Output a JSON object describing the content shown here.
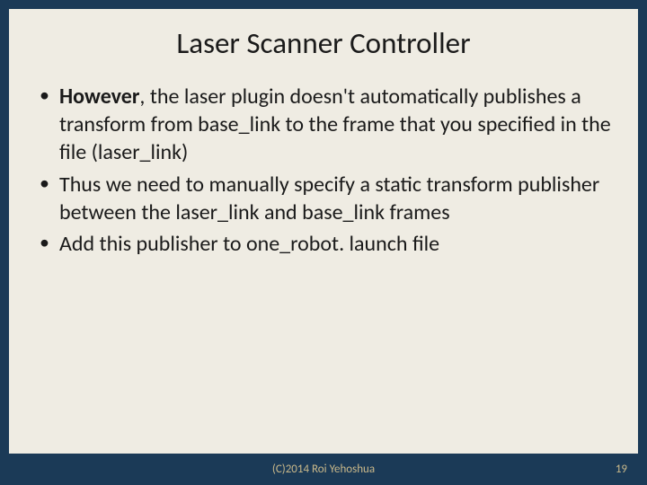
{
  "title": "Laser Scanner Controller",
  "bullets": [
    {
      "bold": "However",
      "rest": ", the laser plugin doesn't automatically publishes a transform from base_link to the frame that you specified in the file (laser_link)"
    },
    {
      "bold": "",
      "rest": "Thus we need to manually specify a static transform publisher between the laser_link and base_link frames"
    },
    {
      "bold": "",
      "rest": "Add this publisher to one_robot. launch file"
    }
  ],
  "footer": {
    "copyright": "(C)2014 Roi Yehoshua",
    "page": "19"
  }
}
